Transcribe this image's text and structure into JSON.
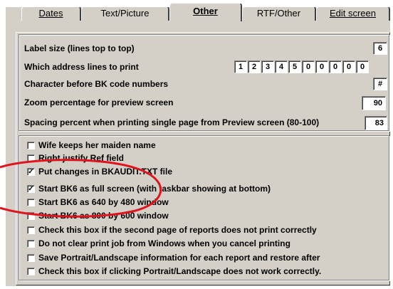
{
  "tabs": [
    {
      "label": "Dates"
    },
    {
      "label": "Text/Picture"
    },
    {
      "label": "Other"
    },
    {
      "label": "RTF/Other"
    },
    {
      "label": "Edit screen"
    }
  ],
  "settings": {
    "label_size": {
      "label": "Label size (lines top to top)",
      "value": "6"
    },
    "address_lines": {
      "label": "Which address lines to print",
      "values": [
        "1",
        "2",
        "3",
        "4",
        "5",
        "0",
        "0",
        "0",
        "0",
        "0"
      ]
    },
    "bk_char": {
      "label": "Character before BK code numbers",
      "value": "#"
    },
    "zoom": {
      "label": "Zoom percentage for preview screen",
      "value": "90"
    },
    "spacing": {
      "label": "Spacing percent when printing single page from Preview screen (80-100)",
      "value": "83"
    }
  },
  "checkboxes": [
    {
      "label": "Wife keeps her maiden name",
      "checked": false
    },
    {
      "label": "Right justify Ref field",
      "checked": false
    },
    {
      "label": "Put changes in BKAUDIT.TXT file",
      "checked": true
    },
    {
      "label": "Start BK6 as full screen (with taskbar showing at bottom)",
      "checked": true
    },
    {
      "label": "Start BK6 as 640 by 480 window",
      "checked": false
    },
    {
      "label": "Start BK6 as 800 by 600 window",
      "checked": false
    },
    {
      "label": "Check this box if the second page of reports does not print correctly",
      "checked": false
    },
    {
      "label": "Do not clear print job from Windows when you cancel printing",
      "checked": false
    },
    {
      "label": "Save Portrait/Landscape information for each report and restore after",
      "checked": false
    },
    {
      "label": "Check this box if clicking Portrait/Landscape does not work correctly.",
      "checked": false
    }
  ],
  "colors": {
    "highlight_circle": "#e0141e",
    "dialog_bg": "#d4d0c8"
  }
}
